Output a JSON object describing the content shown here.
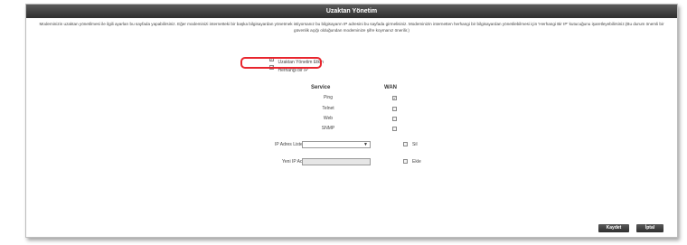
{
  "window": {
    "title": "Uzaktan Yönetim"
  },
  "description": "Modeminizin uzaktan yönetilmesi ile ilgili ayarları bu sayfada yapabilirsiniz. Eğer modeminizi internetteki bir başka bilgisayardan yönetmek istiyorsanız bu bilgisayarın IP adresini bu sayfada girmelisiniz. Modeminizin internetten herhangi bir bilgisayardan yönetilebilmesi için 'Herhangi Bir IP' kutucuğunu işaretleyebilirsiniz.(Bu durum önemli bir güvenlik açığı olduğundan modeminize şifre koymanız önerilir.)",
  "options": {
    "remote_enable": {
      "label": "Uzaktan Yönetim Etkin",
      "checked": true
    },
    "any_ip": {
      "label": "Herhangi bir IP",
      "checked": true
    }
  },
  "services_table": {
    "headers": {
      "service": "Service",
      "wan": "WAN"
    },
    "rows": [
      {
        "service": "Ping",
        "wan": true
      },
      {
        "service": "Telnet",
        "wan": false
      },
      {
        "service": "Web",
        "wan": false
      },
      {
        "service": "SNMP",
        "wan": false
      }
    ]
  },
  "ip_list": {
    "label": "IP Adres Listesi :",
    "selected": "",
    "delete_label": "Sil"
  },
  "new_ip": {
    "label": "Yeni IP Adresi :",
    "value": "",
    "add_label": "Ekle"
  },
  "buttons": {
    "save": "Kaydet",
    "cancel": "İptal"
  },
  "colors": {
    "titlebar": "#3a3a3a",
    "highlight": "#e8262e"
  }
}
